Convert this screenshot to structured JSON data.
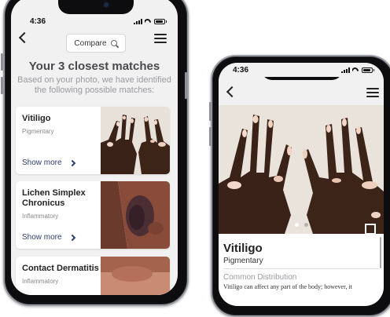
{
  "left_phone": {
    "status_time": "4:36",
    "compare_label": "Compare",
    "heading": "Your 3 closest matches",
    "subheading_line1": "Based on your photo, we have identified",
    "subheading_line2": "the following possible matches:",
    "matches": [
      {
        "title_line1": "Vitiligo",
        "title_line2": "",
        "category": "Pigmentary",
        "more_label": "Show more"
      },
      {
        "title_line1": "Lichen Simplex",
        "title_line2": "Chronicus",
        "category": "Inflammatory",
        "more_label": "Show more"
      },
      {
        "title_line1": "Contact Dermatitis",
        "title_line2": "",
        "category": "Inflammatory",
        "more_label": ""
      }
    ]
  },
  "right_phone": {
    "status_time": "4:36",
    "condition_title": "Vitiligo",
    "condition_category": "Pigmentary",
    "section_label": "Common Distribution",
    "section_text": "Vitiligo can affect any part of the body; however, it",
    "carousel_active_index": 0,
    "carousel_count": 2
  },
  "colors": {
    "accent_link": "#2e3d6b",
    "heading_gray": "#4a4a4e",
    "sub_gray": "#9a9aa0",
    "screen_bg": "#f1f1f2"
  },
  "icons": {
    "back": "chevron-left-icon",
    "menu": "hamburger-menu-icon",
    "search": "search-icon",
    "expand": "fullscreen-expand-icon",
    "show_more": "chevron-right-icon"
  }
}
